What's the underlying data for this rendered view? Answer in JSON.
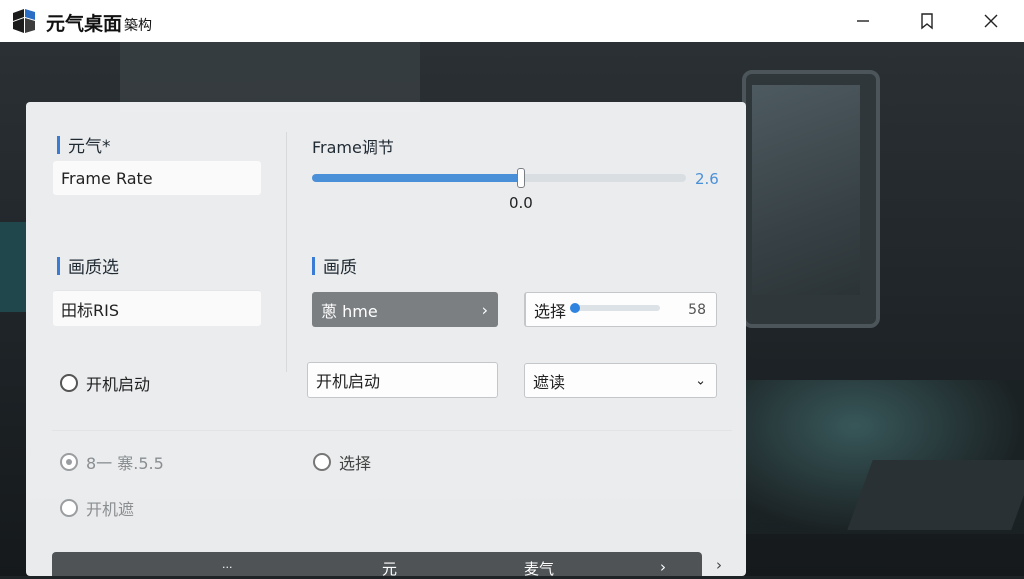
{
  "window": {
    "title_main": "元气桌面",
    "title_sub": "築构"
  },
  "panel": {
    "left_col": {
      "section1_title": "元气*",
      "frame_rate_label": "Frame Rate",
      "section2_title": "画质选",
      "field_value": "田标RIS",
      "radio1_label": "开机启动"
    },
    "right_col": {
      "frame_title": "Frame调节",
      "slider_value": "2.6",
      "slider_min": "0.0",
      "slider_fraction": 0.56,
      "section_title": "画质",
      "dark_button_label": "蔥 hme",
      "select_label": "选择",
      "select_count": "58",
      "autostart_label": "开机启动",
      "dropdown_value": "遮读"
    },
    "lower": {
      "option_left_label": "8一 寨.5.5",
      "option_left2_label": "开机遮",
      "option_right_label": "选择"
    },
    "bottom_bar": {
      "item1": "...",
      "item2": "元",
      "item3": "麦气",
      "arrow": "›"
    }
  },
  "colors": {
    "accent": "#3a7bd5",
    "slider_fill": "#4a90d9",
    "dark_button": "#7b7f82"
  }
}
